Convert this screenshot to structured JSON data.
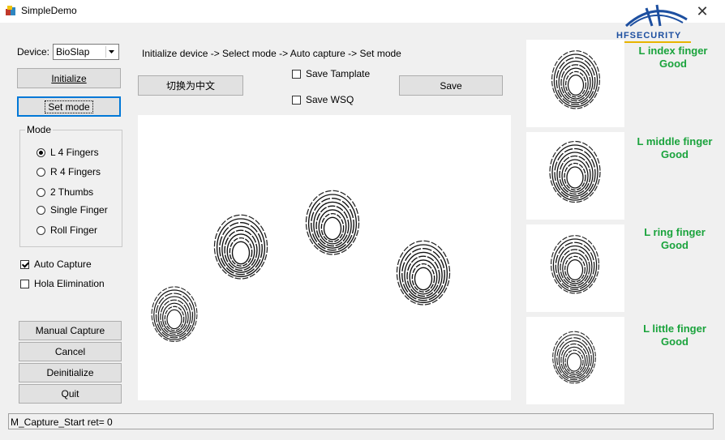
{
  "window": {
    "title": "SimpleDemo",
    "close_glyph": "✕"
  },
  "logo": {
    "text": "HFSECURITY"
  },
  "device": {
    "label": "Device:",
    "selected": "BioSlap"
  },
  "buttons": {
    "initialize": "Initialize",
    "set_mode": "Set mode",
    "switch_lang": "切换为中文",
    "save": "Save",
    "manual_capture": "Manual Capture",
    "cancel": "Cancel",
    "deinitialize": "Deinitialize",
    "quit": "Quit"
  },
  "instructions": "Initialize device -> Select mode -> Auto capture -> Set mode",
  "save_options": {
    "template": "Save Tamplate",
    "wsq": "Save WSQ"
  },
  "mode": {
    "legend": "Mode",
    "options": [
      "L 4 Fingers",
      "R 4 Fingers",
      "2 Thumbs",
      "Single Finger",
      "Roll Finger"
    ],
    "selected_index": 0
  },
  "options": {
    "auto_capture": "Auto Capture",
    "auto_capture_checked": true,
    "hola": "Hola Elimination",
    "hola_checked": false
  },
  "fingers": [
    {
      "name": "L index finger",
      "quality": "Good"
    },
    {
      "name": "L middle finger",
      "quality": "Good"
    },
    {
      "name": "L ring finger",
      "quality": "Good"
    },
    {
      "name": "L little finger",
      "quality": "Good"
    }
  ],
  "status": "M_Capture_Start  ret= 0",
  "colors": {
    "quality_text": "#1aa33c",
    "logo_blue": "#1d4fa0",
    "logo_gold": "#e8b400"
  }
}
